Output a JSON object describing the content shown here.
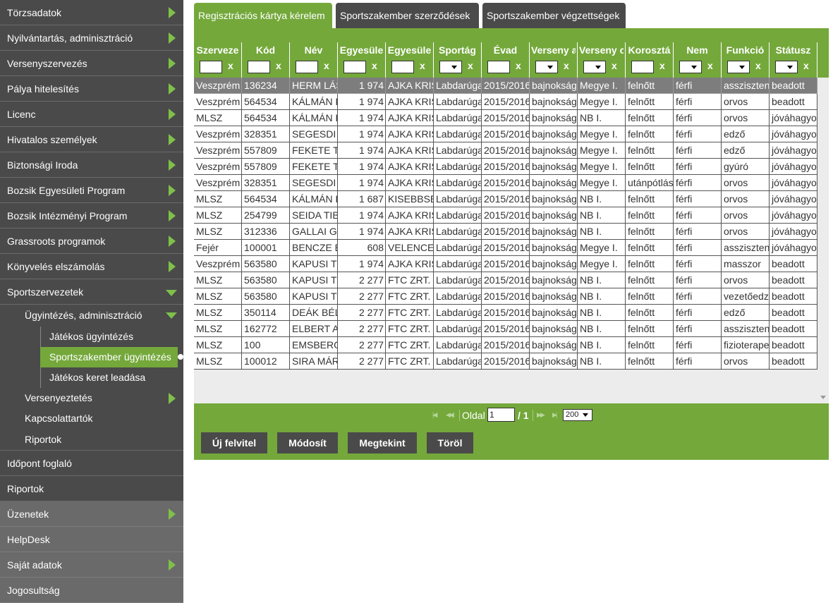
{
  "sidebar": {
    "top_items": [
      {
        "label": "Törzsadatok",
        "expanded": false
      },
      {
        "label": "Nyilvántartás, adminisztráció",
        "expanded": false
      },
      {
        "label": "Versenyszervezés",
        "expanded": false
      },
      {
        "label": "Pálya hitelesítés",
        "expanded": false
      },
      {
        "label": "Licenc",
        "expanded": false
      },
      {
        "label": "Hivatalos személyek",
        "expanded": false
      },
      {
        "label": "Biztonsági Iroda",
        "expanded": false
      },
      {
        "label": "Bozsik Egyesületi Program",
        "expanded": false
      },
      {
        "label": "Bozsik Intézményi Program",
        "expanded": false
      },
      {
        "label": "Grassroots programok",
        "expanded": false
      },
      {
        "label": "Könyvelés elszámolás",
        "expanded": false
      },
      {
        "label": "Sportszervezetek",
        "expanded": true
      }
    ],
    "sportszervezetek_sub": {
      "ugyintezes": {
        "label": "Ügyintézés, adminisztráció"
      },
      "ugyintezes_children": [
        {
          "label": "Játékos ügyintézés",
          "active": false
        },
        {
          "label": "Sportszakember ügyintézés",
          "active": true
        },
        {
          "label": "Játékos keret leadása",
          "active": false
        }
      ],
      "versenyeztetes": {
        "label": "Versenyeztetés"
      },
      "kapcsolattartok": {
        "label": "Kapcsolattartók"
      },
      "riportok": {
        "label": "Riportok"
      }
    },
    "bottom_items": [
      {
        "label": "Időpont foglaló"
      },
      {
        "label": "Riportok"
      },
      {
        "label": "Üzenetek"
      },
      {
        "label": "HelpDesk"
      },
      {
        "label": "Saját adatok"
      },
      {
        "label": "Jogosultság"
      }
    ]
  },
  "tabs": [
    {
      "label": "Regisztrációs kártya kérelem",
      "active": true
    },
    {
      "label": "Sportszakember szerződések",
      "active": false
    },
    {
      "label": "Sportszakember végzettségek",
      "active": false
    }
  ],
  "grid": {
    "columns": [
      {
        "title": "Szerveze",
        "filter": "text",
        "clear": "x"
      },
      {
        "title": "Kód",
        "filter": "text",
        "clear": "x"
      },
      {
        "title": "Név",
        "filter": "text",
        "clear": "x"
      },
      {
        "title": "Egyesüle",
        "filter": "text",
        "clear": "x"
      },
      {
        "title": "Egyesüle",
        "filter": "text",
        "clear": "x"
      },
      {
        "title": "Sportág",
        "filter": "select",
        "clear": "x"
      },
      {
        "title": "Évad",
        "filter": "text",
        "clear": "x"
      },
      {
        "title": "Verseny a",
        "filter": "select",
        "clear": "x"
      },
      {
        "title": "Verseny c",
        "filter": "select",
        "clear": "x"
      },
      {
        "title": "Korosztá",
        "filter": "text",
        "clear": "x"
      },
      {
        "title": "Nem",
        "filter": "select",
        "clear": "x"
      },
      {
        "title": "Funkció",
        "filter": "select",
        "clear": "x"
      },
      {
        "title": "Státusz",
        "filter": "select",
        "clear": "x"
      }
    ],
    "rows": [
      [
        "Veszprém",
        "136234",
        "HERM LÁS",
        "1 974",
        "AJKA KRIS",
        "Labdarúga",
        "2015/2016",
        "bajnokság",
        "Megye I.",
        "felnőtt",
        "férfi",
        "asszisztens",
        "beadott"
      ],
      [
        "Veszprém",
        "564534",
        "KÁLMÁN K",
        "1 974",
        "AJKA KRIS",
        "Labdarúga",
        "2015/2016",
        "bajnokság",
        "Megye I.",
        "felnőtt",
        "férfi",
        "orvos",
        "beadott"
      ],
      [
        "MLSZ",
        "564534",
        "KÁLMÁN K",
        "1 974",
        "AJKA KRIS",
        "Labdarúga",
        "2015/2016",
        "bajnokság",
        "NB I.",
        "felnőtt",
        "férfi",
        "orvos",
        "jóváhagyo"
      ],
      [
        "Veszprém",
        "328351",
        "SEGESDI",
        "1 974",
        "AJKA KRIS",
        "Labdarúga",
        "2015/2016",
        "bajnokság",
        "Megye I.",
        "felnőtt",
        "férfi",
        "edző",
        "jóváhagyo"
      ],
      [
        "Veszprém",
        "557809",
        "FEKETE T",
        "1 974",
        "AJKA KRIS",
        "Labdarúga",
        "2015/2016",
        "bajnokság",
        "Megye I.",
        "felnőtt",
        "férfi",
        "edző",
        "jóváhagyo"
      ],
      [
        "Veszprém",
        "557809",
        "FEKETE T",
        "1 974",
        "AJKA KRIS",
        "Labdarúga",
        "2015/2016",
        "bajnokság",
        "Megye I.",
        "felnőtt",
        "férfi",
        "gyúró",
        "jóváhagyo"
      ],
      [
        "Veszprém",
        "328351",
        "SEGESDI",
        "1 974",
        "AJKA KRIS",
        "Labdarúga",
        "2015/2016",
        "bajnokság",
        "Megye I.",
        "utánpótlás",
        "férfi",
        "orvos",
        "jóváhagyo"
      ],
      [
        "MLSZ",
        "564534",
        "KÁLMÁN K",
        "1 687",
        "KISEBBSÉ",
        "Labdarúga",
        "2015/2016",
        "bajnokság",
        "NB I.",
        "felnőtt",
        "férfi",
        "orvos",
        "jóváhagyo"
      ],
      [
        "MLSZ",
        "254799",
        "SEIDA TIB",
        "1 974",
        "AJKA KRIS",
        "Labdarúga",
        "2015/2016",
        "bajnokság",
        "NB I.",
        "felnőtt",
        "férfi",
        "orvos",
        "jóváhagyo"
      ],
      [
        "MLSZ",
        "312336",
        "GALLAI G",
        "1 974",
        "AJKA KRIS",
        "Labdarúga",
        "2015/2016",
        "bajnokság",
        "NB I.",
        "felnőtt",
        "férfi",
        "orvos",
        "jóváhagyo"
      ],
      [
        "Fejér",
        "100001",
        "BENCZE B",
        "608",
        "VELENCE",
        "Labdarúga",
        "2015/2016",
        "bajnokság",
        "Megye I.",
        "felnőtt",
        "férfi",
        "asszisztens",
        "jóváhagyo"
      ],
      [
        "Veszprém",
        "563580",
        "KAPUSI T",
        "1 974",
        "AJKA KRIS",
        "Labdarúga",
        "2015/2016",
        "bajnokság",
        "Megye I.",
        "felnőtt",
        "férfi",
        "masszor",
        "beadott"
      ],
      [
        "MLSZ",
        "563580",
        "KAPUSI T",
        "2 277",
        "FTC ZRT.",
        "Labdarúga",
        "2015/2016",
        "bajnokság",
        "NB I.",
        "felnőtt",
        "férfi",
        "orvos",
        "beadott"
      ],
      [
        "MLSZ",
        "563580",
        "KAPUSI T",
        "2 277",
        "FTC ZRT.",
        "Labdarúga",
        "2015/2016",
        "bajnokság",
        "NB I.",
        "felnőtt",
        "férfi",
        "vezetőedz",
        "beadott"
      ],
      [
        "MLSZ",
        "350114",
        "DEÁK BÉL",
        "2 277",
        "FTC ZRT.",
        "Labdarúga",
        "2015/2016",
        "bajnokság",
        "NB I.",
        "felnőtt",
        "férfi",
        "edző",
        "beadott"
      ],
      [
        "MLSZ",
        "162772",
        "ELBERT A",
        "2 277",
        "FTC ZRT.",
        "Labdarúga",
        "2015/2016",
        "bajnokság",
        "NB I.",
        "felnőtt",
        "férfi",
        "asszisztens",
        "beadott"
      ],
      [
        "MLSZ",
        "100",
        "EMSBERG",
        "2 277",
        "FTC ZRT.",
        "Labdarúga",
        "2015/2016",
        "bajnokság",
        "NB I.",
        "felnőtt",
        "férfi",
        "fizioterape",
        "beadott"
      ],
      [
        "MLSZ",
        "100012",
        "SIRA MÁR",
        "2 277",
        "FTC ZRT.",
        "Labdarúga",
        "2015/2016",
        "bajnokság",
        "NB I.",
        "felnőtt",
        "férfi",
        "orvos",
        "beadott"
      ]
    ],
    "selected_row": 0
  },
  "pager": {
    "page_label": "Oldal",
    "page_value": "1",
    "page_total": "/ 1",
    "page_size": "200"
  },
  "buttons": {
    "new": "Új felvitel",
    "edit": "Módosít",
    "view": "Megtekint",
    "delete": "Töröl"
  },
  "colors": {
    "accent_green": "#74a83b",
    "sidebar_dark": "#4a4a4a",
    "arrow_green": "#7fc04a"
  }
}
